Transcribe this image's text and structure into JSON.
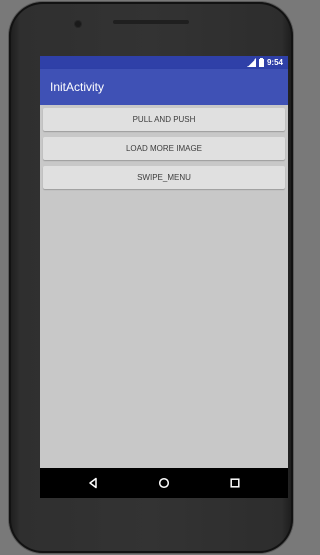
{
  "device": {
    "status_bar": {
      "time": "9:54",
      "icons": [
        "signal-icon",
        "battery-icon"
      ]
    },
    "navigation": {
      "icons": [
        "back-icon",
        "home-icon",
        "recent-apps-icon"
      ]
    }
  },
  "app": {
    "title": "InitActivity",
    "colors": {
      "primary": "#3F51B5",
      "primary_dark": "#2F40A8",
      "background": "#C8C8C8",
      "button": "#E0E0E0",
      "button_text": "#3C3C3C"
    }
  },
  "buttons": [
    {
      "label": "PULL AND PUSH"
    },
    {
      "label": "LOAD MORE IMAGE"
    },
    {
      "label": "SWIPE_MENU"
    }
  ]
}
